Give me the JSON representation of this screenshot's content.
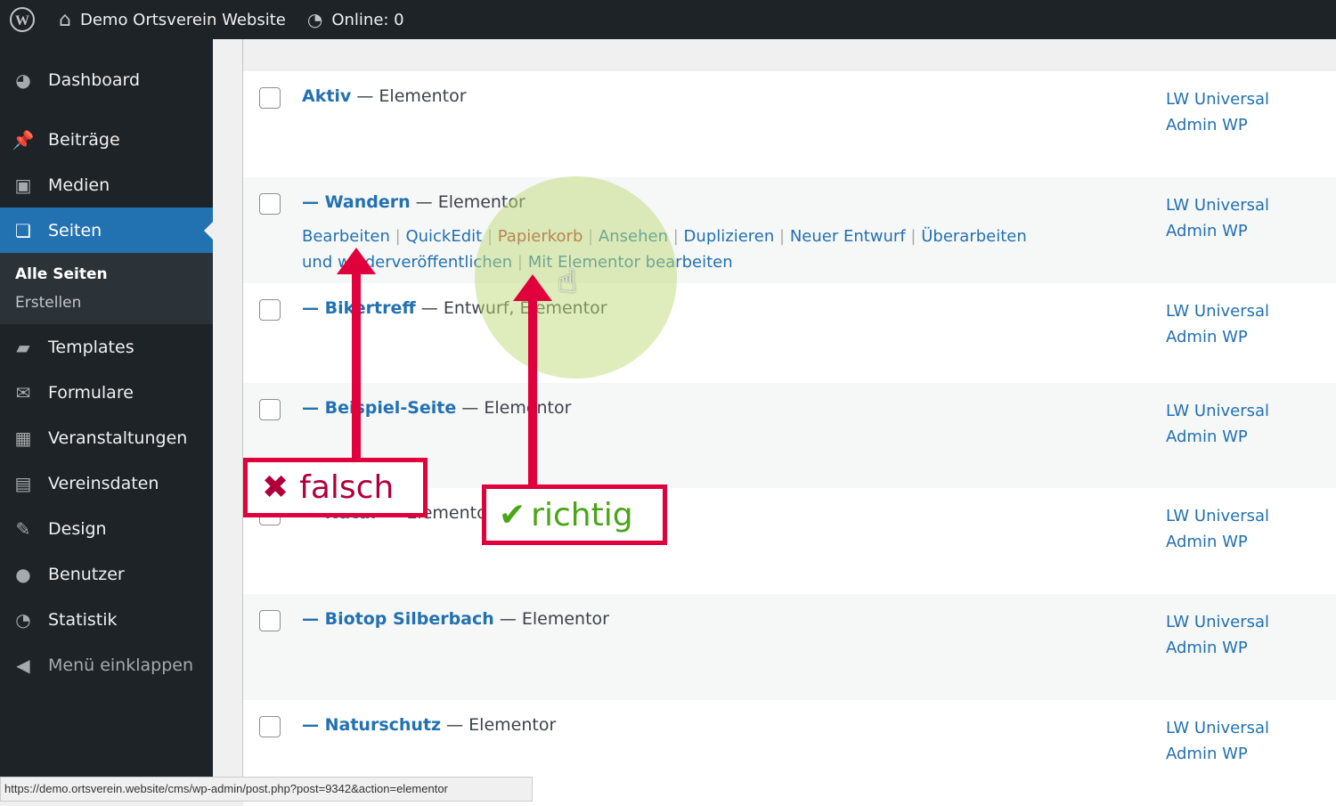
{
  "topbar": {
    "site": "Demo Ortsverein Website",
    "online": "Online: 0"
  },
  "sidebar": {
    "items": [
      {
        "label": "Dashboard",
        "icon": "dashboard-icon"
      },
      {
        "label": "Beiträge",
        "icon": "pin-icon"
      },
      {
        "label": "Medien",
        "icon": "media-icon"
      },
      {
        "label": "Seiten",
        "icon": "pages-icon",
        "active": true
      },
      {
        "label": "Templates",
        "icon": "folder-icon"
      },
      {
        "label": "Formulare",
        "icon": "mail-icon"
      },
      {
        "label": "Veranstaltungen",
        "icon": "calendar-icon"
      },
      {
        "label": "Vereinsdaten",
        "icon": "id-card-icon"
      },
      {
        "label": "Design",
        "icon": "brush-icon"
      },
      {
        "label": "Benutzer",
        "icon": "user-icon"
      },
      {
        "label": "Statistik",
        "icon": "pie-icon"
      },
      {
        "label": "Menü einklappen",
        "icon": "collapse-icon"
      }
    ],
    "sub": [
      "Alle Seiten",
      "Erstellen"
    ]
  },
  "rows": [
    {
      "title": "Aktiv",
      "state": " — Elementor",
      "author": [
        "LW Universal",
        "Admin WP"
      ]
    },
    {
      "title": "— Wandern",
      "state": " — Elementor",
      "author": [
        "LW Universal",
        "Admin WP"
      ]
    },
    {
      "title": "— Bikertreff",
      "state": " — Entwurf, Elementor",
      "author": [
        "LW Universal",
        "Admin WP"
      ]
    },
    {
      "title": "— Beispiel-Seite",
      "state": " — Elementor",
      "author": [
        "LW Universal",
        "Admin WP"
      ]
    },
    {
      "title": "— Natur",
      "state": " — Elementor",
      "author": [
        "LW Universal",
        "Admin WP"
      ]
    },
    {
      "title": "— Biotop Silberbach",
      "state": " — Elementor",
      "author": [
        "LW Universal",
        "Admin WP"
      ]
    },
    {
      "title": "— Naturschutz",
      "state": " — Elementor",
      "author": [
        "LW Universal",
        "Admin WP"
      ]
    }
  ],
  "row_actions": [
    "Bearbeiten",
    "QuickEdit",
    "Papierkorb",
    "Ansehen",
    "Duplizieren",
    "Neuer Entwurf",
    "Überarbeiten und wiederveröffentlichen",
    "Mit Elementor bearbeiten"
  ],
  "annotations": {
    "wrong": "falsch",
    "right": "richtig",
    "wrong_color": "#b0003a",
    "right_color": "#4aa517",
    "arrow_color": "#e0003c"
  },
  "statusbar": "https://demo.ortsverein.website/cms/wp-admin/post.php?post=9342&action=elementor"
}
